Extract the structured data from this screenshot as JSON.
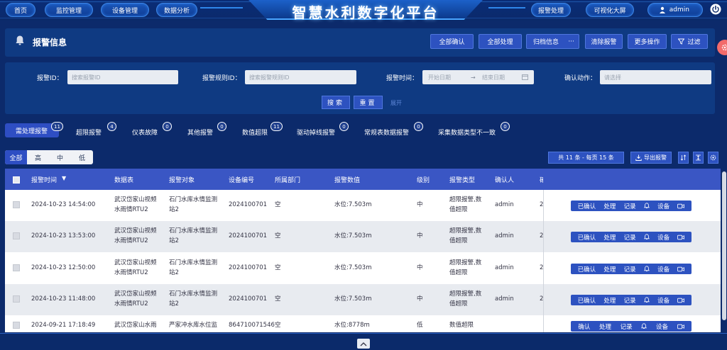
{
  "topnav": {
    "home": "首页",
    "monitor": "监控管理",
    "device": "设备管理",
    "analysis": "数据分析",
    "platform_title": "智慧水利数字化平台",
    "alarm": "报警处理",
    "bigscreen": "可视化大屏",
    "user": "admin"
  },
  "header": {
    "title": "报警信息",
    "buttons": [
      "全部确认",
      "全部处理",
      "归档信息",
      "清除报警",
      "更多操作",
      "过滤"
    ],
    "more_dots": "···"
  },
  "filters": {
    "alarm_id_label": "报警ID：",
    "alarm_id_placeholder": "搜索报警ID",
    "rule_id_label": "报警规则ID：",
    "rule_id_placeholder": "搜索报警规则ID",
    "time_label": "报警时间：",
    "start_placeholder": "开始日期",
    "arrow": "→",
    "end_placeholder": "结束日期",
    "confirm_label": "确认动作：",
    "confirm_placeholder": "请选择",
    "search": "搜索",
    "reset": "重置",
    "expand": "展开"
  },
  "tabs": [
    {
      "label": "需处理报警",
      "count": "11"
    },
    {
      "label": "超限报警",
      "count": "4"
    },
    {
      "label": "仪表故障",
      "count": "0"
    },
    {
      "label": "其他报警",
      "count": "0"
    },
    {
      "label": "数值超限",
      "count": "11"
    },
    {
      "label": "驱动掉线报警",
      "count": "0"
    },
    {
      "label": "常规表数据报警",
      "count": "0"
    },
    {
      "label": "采集数据类型不一致",
      "count": "0"
    }
  ],
  "levels": [
    "全部",
    "高",
    "中",
    "低"
  ],
  "toolbar": {
    "total": "共 11 条 - 每页 15 条",
    "export": "导出报警"
  },
  "table": {
    "columns": [
      "报警时间",
      "数据表",
      "报警对象",
      "设备编号",
      "所属部门",
      "报警数值",
      "级别",
      "报警类型",
      "确认人",
      "確"
    ],
    "sort_arrow": "▼",
    "rows": [
      {
        "time": "2024-10-23 14:54:00",
        "table1": "武汉岱家山视频",
        "table2": "水雨情RTU2",
        "obj1": "石门水库水情监测",
        "obj2": "站2",
        "device": "2024100701",
        "dept": "空",
        "value": "水位:7.503m",
        "level": "中",
        "type1": "超限报警,数",
        "type2": "值超限",
        "user": "admin",
        "extra": "2"
      },
      {
        "time": "2024-10-23 13:53:00",
        "table1": "武汉岱家山视频",
        "table2": "水雨情RTU2",
        "obj1": "石门水库水情监测",
        "obj2": "站2",
        "device": "2024100701",
        "dept": "空",
        "value": "水位:7.503m",
        "level": "中",
        "type1": "超限报警,数",
        "type2": "值超限",
        "user": "admin",
        "extra": "2"
      },
      {
        "time": "2024-10-23 12:50:00",
        "table1": "武汉岱家山视频",
        "table2": "水雨情RTU2",
        "obj1": "石门水库水情监测",
        "obj2": "站2",
        "device": "2024100701",
        "dept": "空",
        "value": "水位:7.503m",
        "level": "中",
        "type1": "超限报警,数",
        "type2": "值超限",
        "user": "admin",
        "extra": "2"
      },
      {
        "time": "2024-10-23 11:48:00",
        "table1": "武汉岱家山视频",
        "table2": "水雨情RTU2",
        "obj1": "石门水库水情监测",
        "obj2": "站2",
        "device": "2024100701",
        "dept": "空",
        "value": "水位:7.503m",
        "level": "中",
        "type1": "超限报警,数",
        "type2": "值超限",
        "user": "admin",
        "extra": "2"
      },
      {
        "time": "2024-09-21 17:18:49",
        "table1": "武汉岱家山水雨",
        "table2": "",
        "obj1": "严家冲水库水位监",
        "obj2": "",
        "device": "864710071546",
        "dept": "空",
        "value": "水位:8778m",
        "level": "低",
        "type1": "数值超限",
        "type2": "",
        "user": "",
        "extra": ""
      }
    ],
    "actions": [
      "已确认",
      "处理",
      "记录",
      "设备"
    ],
    "actions_last": [
      "确认",
      "处理",
      "记录",
      "设备"
    ]
  },
  "colors": {
    "page_bg": "#0c2a6b",
    "card_bg": "#0f3a82",
    "accent": "#2d52c0",
    "header_row": "#3a56c4",
    "fab": "#f26b6b"
  }
}
